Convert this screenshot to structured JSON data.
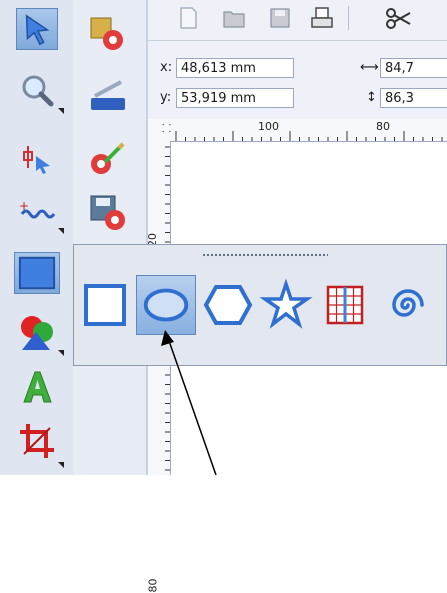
{
  "toolbox": {
    "tools": [
      {
        "name": "selector-tool"
      },
      {
        "name": "zoom-tool"
      },
      {
        "name": "node-tool"
      },
      {
        "name": "freehand-tool"
      },
      {
        "name": "rectangle-tool"
      },
      {
        "name": "fill-tool"
      },
      {
        "name": "text-tool"
      },
      {
        "name": "crop-tool"
      }
    ]
  },
  "toolbox2": {
    "tools": [
      {
        "name": "effects-tool"
      },
      {
        "name": "eraser-tool"
      },
      {
        "name": "repair-tool"
      },
      {
        "name": "export-tool"
      }
    ]
  },
  "property_bar": {
    "x_label": "x:",
    "x_value": "48,613 mm",
    "y_label": "y:",
    "y_value": "53,919 mm",
    "width_value": "84,7",
    "height_value": "86,3"
  },
  "ruler": {
    "top_labels": [
      "100",
      "80"
    ],
    "left_labels": [
      "120",
      "80"
    ]
  },
  "flyout": {
    "tools": [
      {
        "name": "rectangle-shape-tool"
      },
      {
        "name": "ellipse-shape-tool",
        "selected": true
      },
      {
        "name": "polygon-shape-tool"
      },
      {
        "name": "star-shape-tool"
      },
      {
        "name": "table-shape-tool"
      },
      {
        "name": "spiral-shape-tool"
      }
    ]
  },
  "colors": {
    "accent": "#2f6fcf",
    "toolbox_bg": "#dfe6f1"
  }
}
